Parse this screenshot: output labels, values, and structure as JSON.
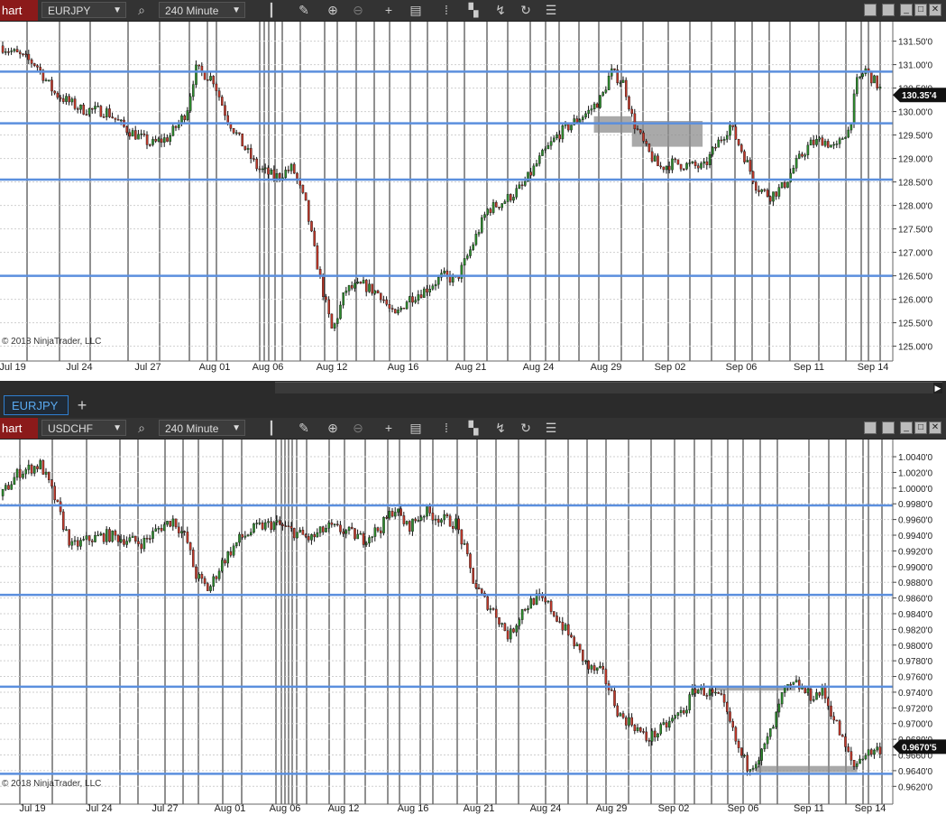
{
  "tabs": [
    {
      "label": "EURJPY"
    }
  ],
  "add_tab_label": "+",
  "charts": [
    {
      "chart_tab": "hart",
      "instrument": "EURJPY",
      "interval": "240 Minute",
      "copyright": "2018 NinjaTrader, LLC",
      "price_tag": "130.35'4",
      "price_tag_value": 130.354,
      "colors": {
        "up": "#2e8b2e",
        "down": "#c0392b",
        "level_line": "#5b8fde",
        "zone": "#8c8c8c"
      },
      "chart_data": {
        "type": "candlestick",
        "x": [
          "Jul 19",
          "Jul 24",
          "Jul 27",
          "Aug 01",
          "Aug 06",
          "Aug 12",
          "Aug 16",
          "Aug 21",
          "Aug 24",
          "Aug 29",
          "Sep 02",
          "Sep 06",
          "Sep 11",
          "Sep 14"
        ],
        "y_ticks": [
          "131.50'0",
          "131.00'0",
          "130.50'0",
          "130.00'0",
          "129.50'0",
          "129.00'0",
          "128.50'0",
          "128.00'0",
          "127.50'0",
          "127.00'0",
          "126.50'0",
          "126.00'0",
          "125.50'0",
          "125.00'0"
        ],
        "ylim": [
          124.8,
          131.8
        ],
        "levels": [
          130.85,
          129.75,
          128.55,
          126.5
        ],
        "zones": [
          {
            "x0": 0.672,
            "x1": 0.715,
            "y0": 129.55,
            "y1": 129.9
          },
          {
            "x0": 0.715,
            "x1": 0.795,
            "y0": 129.25,
            "y1": 129.8
          }
        ],
        "path": [
          [
            0,
            131.4
          ],
          [
            0.04,
            131.0
          ],
          [
            0.06,
            130.4
          ],
          [
            0.09,
            130.05
          ],
          [
            0.12,
            130.0
          ],
          [
            0.14,
            129.65
          ],
          [
            0.17,
            129.3
          ],
          [
            0.19,
            129.45
          ],
          [
            0.21,
            130.0
          ],
          [
            0.22,
            130.9
          ],
          [
            0.24,
            130.7
          ],
          [
            0.255,
            129.9
          ],
          [
            0.27,
            129.4
          ],
          [
            0.29,
            128.8
          ],
          [
            0.31,
            128.6
          ],
          [
            0.33,
            128.8
          ],
          [
            0.345,
            128.0
          ],
          [
            0.355,
            127.0
          ],
          [
            0.365,
            126.1
          ],
          [
            0.375,
            125.3
          ],
          [
            0.39,
            126.2
          ],
          [
            0.41,
            126.3
          ],
          [
            0.43,
            126.1
          ],
          [
            0.445,
            125.6
          ],
          [
            0.46,
            126.0
          ],
          [
            0.48,
            126.2
          ],
          [
            0.5,
            126.5
          ],
          [
            0.515,
            126.4
          ],
          [
            0.53,
            127.0
          ],
          [
            0.55,
            127.9
          ],
          [
            0.57,
            128.1
          ],
          [
            0.59,
            128.4
          ],
          [
            0.61,
            129.0
          ],
          [
            0.63,
            129.5
          ],
          [
            0.65,
            129.8
          ],
          [
            0.665,
            130.0
          ],
          [
            0.68,
            130.3
          ],
          [
            0.69,
            130.85
          ],
          [
            0.705,
            130.6
          ],
          [
            0.715,
            129.8
          ],
          [
            0.73,
            129.2
          ],
          [
            0.745,
            128.8
          ],
          [
            0.76,
            128.9
          ],
          [
            0.78,
            128.85
          ],
          [
            0.795,
            128.8
          ],
          [
            0.81,
            129.3
          ],
          [
            0.825,
            129.7
          ],
          [
            0.84,
            129.1
          ],
          [
            0.855,
            128.4
          ],
          [
            0.87,
            128.2
          ],
          [
            0.885,
            128.4
          ],
          [
            0.9,
            128.9
          ],
          [
            0.915,
            129.3
          ],
          [
            0.93,
            129.4
          ],
          [
            0.945,
            129.2
          ],
          [
            0.955,
            129.55
          ],
          [
            0.96,
            129.6
          ],
          [
            0.968,
            130.6
          ],
          [
            0.978,
            130.9
          ],
          [
            0.99,
            130.6
          ],
          [
            1.0,
            130.35
          ]
        ]
      }
    },
    {
      "chart_tab": "hart",
      "instrument": "USDCHF",
      "interval": "240 Minute",
      "copyright": "2018 NinjaTrader, LLC",
      "price_tag": "0.9670'5",
      "price_tag_value": 0.96705,
      "colors": {
        "up": "#2e8b2e",
        "down": "#c0392b",
        "level_line": "#5b8fde",
        "zone": "#8c8c8c"
      },
      "chart_data": {
        "type": "candlestick",
        "x": [
          "Jul 19",
          "Jul 24",
          "Jul 27",
          "Aug 01",
          "Aug 06",
          "Aug 12",
          "Aug 16",
          "Aug 21",
          "Aug 24",
          "Aug 29",
          "Sep 02",
          "Sep 06",
          "Sep 11",
          "Sep 14"
        ],
        "y_ticks": [
          "1.0040'0",
          "1.0020'0",
          "1.0000'0",
          "0.9980'0",
          "0.9960'0",
          "0.9940'0",
          "0.9920'0",
          "0.9900'0",
          "0.9880'0",
          "0.9860'0",
          "0.9840'0",
          "0.9820'0",
          "0.9800'0",
          "0.9780'0",
          "0.9760'0",
          "0.9740'0",
          "0.9720'0",
          "0.9700'0",
          "0.9680'0",
          "0.9660'0",
          "0.9640'0",
          "0.9620'0"
        ],
        "ylim": [
          0.961,
          1.0055
        ],
        "levels": [
          0.9978,
          0.9864,
          0.9747,
          0.9636
        ],
        "zones": [
          {
            "x0": 0.81,
            "x1": 0.9,
            "y0": 0.9742,
            "y1": 0.9747
          },
          {
            "x0": 0.855,
            "x1": 0.97,
            "y0": 0.9638,
            "y1": 0.9646
          }
        ],
        "path": [
          [
            0,
            0.999
          ],
          [
            0.02,
            1.002
          ],
          [
            0.045,
            1.003
          ],
          [
            0.06,
            0.999
          ],
          [
            0.07,
            0.9955
          ],
          [
            0.08,
            0.9925
          ],
          [
            0.1,
            0.9935
          ],
          [
            0.12,
            0.994
          ],
          [
            0.14,
            0.9935
          ],
          [
            0.16,
            0.993
          ],
          [
            0.18,
            0.995
          ],
          [
            0.195,
            0.996
          ],
          [
            0.21,
            0.9935
          ],
          [
            0.22,
            0.989
          ],
          [
            0.235,
            0.987
          ],
          [
            0.25,
            0.9905
          ],
          [
            0.27,
            0.9935
          ],
          [
            0.29,
            0.995
          ],
          [
            0.31,
            0.9955
          ],
          [
            0.33,
            0.9945
          ],
          [
            0.35,
            0.9935
          ],
          [
            0.37,
            0.995
          ],
          [
            0.39,
            0.9945
          ],
          [
            0.41,
            0.9935
          ],
          [
            0.43,
            0.995
          ],
          [
            0.445,
            0.9975
          ],
          [
            0.46,
            0.995
          ],
          [
            0.48,
            0.997
          ],
          [
            0.5,
            0.996
          ],
          [
            0.515,
            0.9955
          ],
          [
            0.525,
            0.992
          ],
          [
            0.535,
            0.988
          ],
          [
            0.545,
            0.986
          ],
          [
            0.56,
            0.984
          ],
          [
            0.575,
            0.981
          ],
          [
            0.59,
            0.9845
          ],
          [
            0.605,
            0.986
          ],
          [
            0.62,
            0.985
          ],
          [
            0.635,
            0.9825
          ],
          [
            0.65,
            0.98
          ],
          [
            0.665,
            0.977
          ],
          [
            0.68,
            0.9765
          ],
          [
            0.69,
            0.974
          ],
          [
            0.7,
            0.971
          ],
          [
            0.715,
            0.97
          ],
          [
            0.73,
            0.968
          ],
          [
            0.745,
            0.969
          ],
          [
            0.76,
            0.9705
          ],
          [
            0.775,
            0.972
          ],
          [
            0.785,
            0.9745
          ],
          [
            0.8,
            0.974
          ],
          [
            0.815,
            0.973
          ],
          [
            0.825,
            0.97
          ],
          [
            0.835,
            0.9665
          ],
          [
            0.845,
            0.9645
          ],
          [
            0.86,
            0.966
          ],
          [
            0.875,
            0.97
          ],
          [
            0.885,
            0.974
          ],
          [
            0.9,
            0.975
          ],
          [
            0.915,
            0.9735
          ],
          [
            0.93,
            0.974
          ],
          [
            0.945,
            0.97
          ],
          [
            0.955,
            0.967
          ],
          [
            0.965,
            0.9645
          ],
          [
            0.975,
            0.966
          ],
          [
            1.0,
            0.96705
          ]
        ]
      }
    }
  ]
}
